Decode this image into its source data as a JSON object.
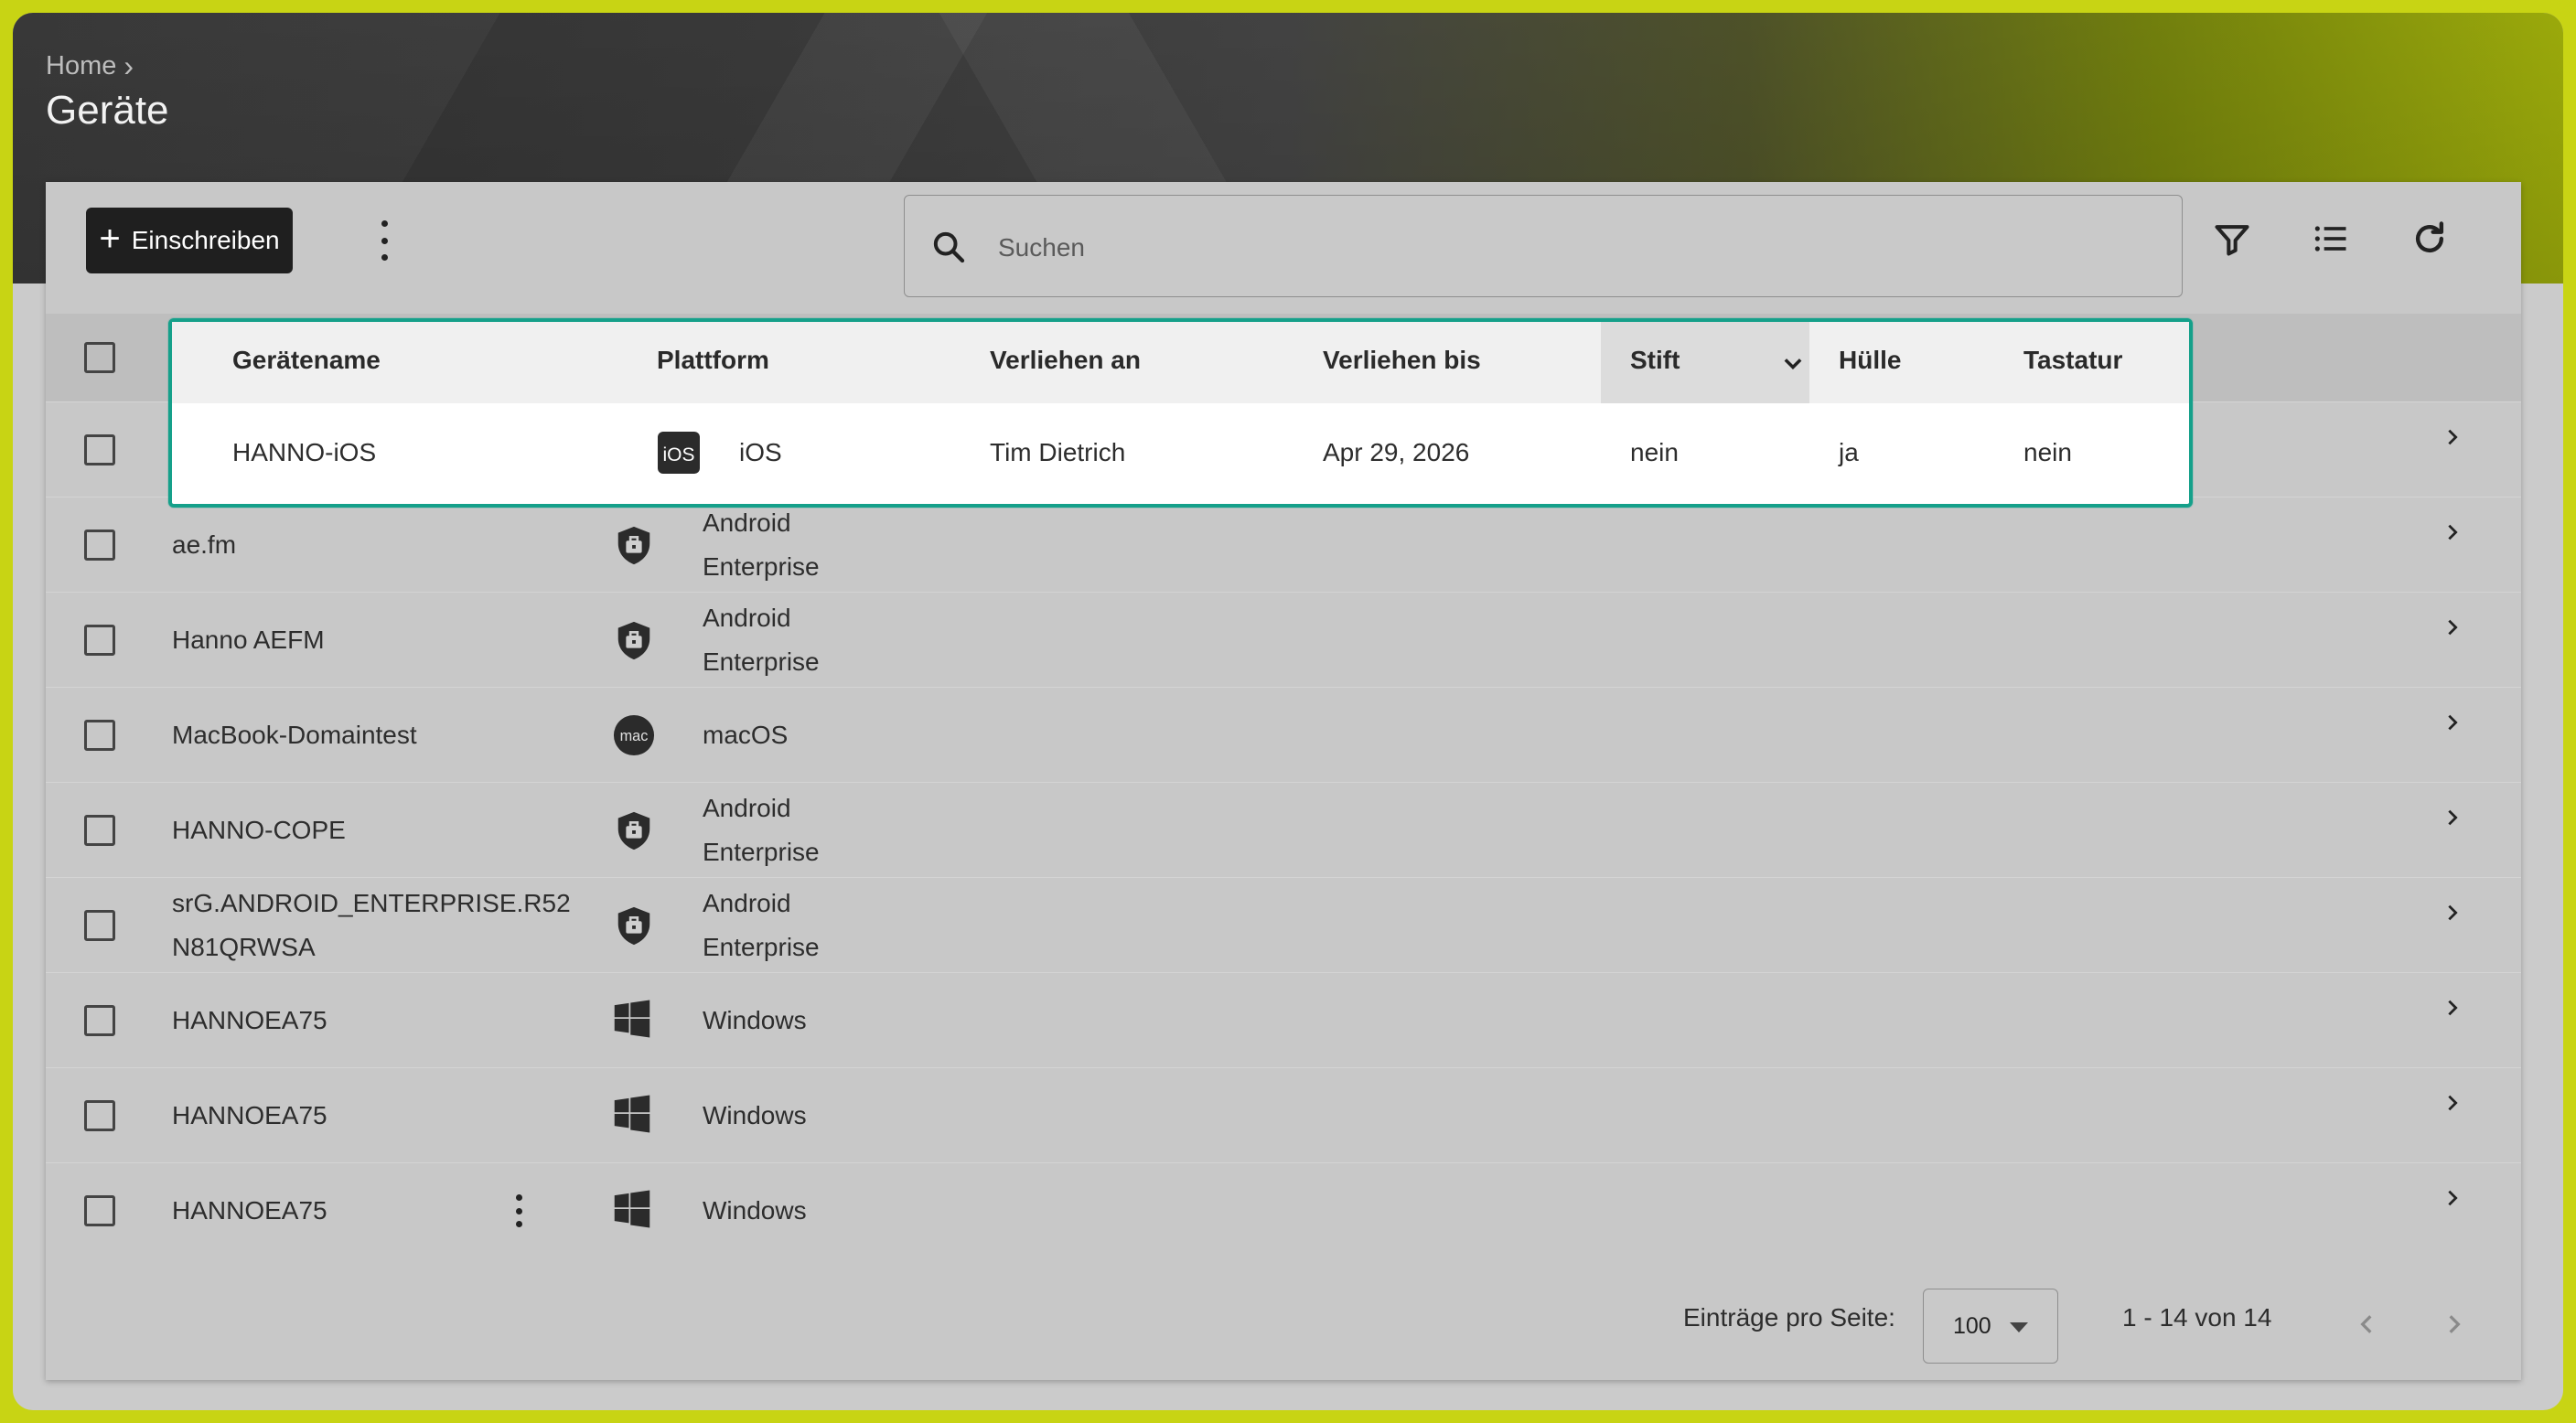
{
  "breadcrumb": {
    "home": "Home",
    "separator": "›"
  },
  "page": {
    "title": "Geräte"
  },
  "toolbar": {
    "enroll_label": "Einschreiben",
    "search_placeholder": "Suchen"
  },
  "columns": {
    "name": "Gerätename",
    "platform": "Plattform",
    "lent_to": "Verliehen an",
    "lent_until": "Verliehen bis",
    "pen": "Stift",
    "case": "Hülle",
    "keyboard": "Tastatur"
  },
  "rows": [
    {
      "name": "HANNO-iOS",
      "platform_icon": "ios-icon",
      "platform": "iOS",
      "lent_to": "Tim Dietrich",
      "lent_until": "Apr 29, 2026",
      "pen": "nein",
      "case": "ja",
      "keyboard": "nein"
    },
    {
      "name": "ae.fm",
      "platform_icon": "android-enterprise-icon",
      "platform_line1": "Android",
      "platform_line2": "Enterprise"
    },
    {
      "name": "Hanno AEFM",
      "platform_icon": "android-enterprise-icon",
      "platform_line1": "Android",
      "platform_line2": "Enterprise"
    },
    {
      "name": "MacBook-Domaintest",
      "platform_icon": "macos-icon",
      "platform": "macOS"
    },
    {
      "name": "HANNO-COPE",
      "platform_icon": "android-enterprise-icon",
      "platform_line1": "Android",
      "platform_line2": "Enterprise"
    },
    {
      "name_line1": "srG.ANDROID_ENTERPRISE.R52",
      "name_line2": "N81QRWSA",
      "platform_icon": "android-enterprise-icon",
      "platform_line1": "Android",
      "platform_line2": "Enterprise"
    },
    {
      "name": "HANNOEA75",
      "platform_icon": "windows-icon",
      "platform": "Windows"
    },
    {
      "name": "HANNOEA75",
      "platform_icon": "windows-icon",
      "platform": "Windows"
    },
    {
      "name": "HANNOEA75",
      "platform_icon": "windows-icon",
      "platform": "Windows"
    }
  ],
  "footer": {
    "per_page_label": "Einträge pro Seite:",
    "per_page_value": "100",
    "range": "1 - 14 von 14"
  },
  "colors": {
    "accent_border": "#15a08a",
    "button_bg": "#1f1f1f",
    "page_bg": "#c8d414"
  }
}
